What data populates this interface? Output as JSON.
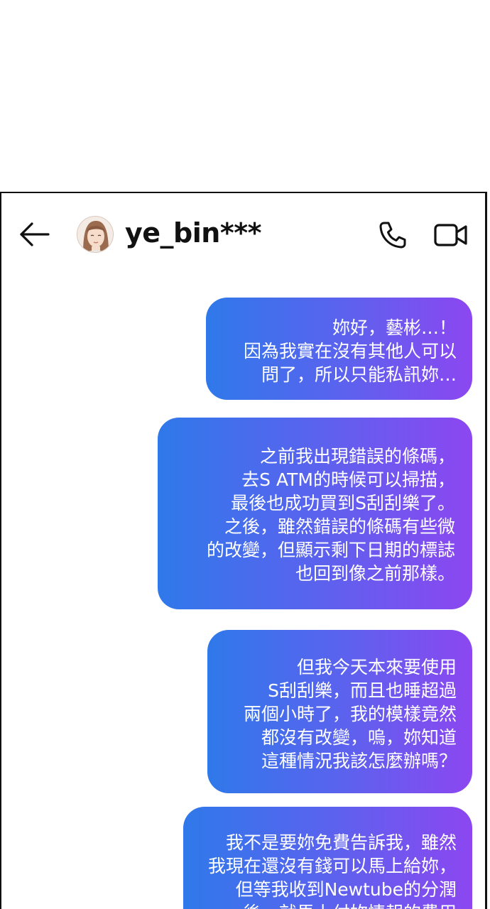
{
  "header": {
    "back_icon": "arrow-left-icon",
    "username": "ye_bin***",
    "call_icon": "phone-icon",
    "video_icon": "video-camera-icon"
  },
  "messages": [
    {
      "lines": [
        "妳好，藝彬…！",
        "因為我實在沒有其他人可以",
        "問了，所以只能私訊妳…"
      ]
    },
    {
      "lines": [
        "之前我出現錯誤的條碼，",
        "去S ATM的時候可以掃描，",
        "最後也成功買到S刮刮樂了。",
        "之後，雖然錯誤的條碼有些微",
        "的改變，但顯示剩下日期的標誌",
        "也回到像之前那樣。"
      ]
    },
    {
      "lines": [
        "但我今天本來要使用",
        "S刮刮樂，而且也睡超過",
        "兩個小時了，我的模樣竟然",
        "都沒有改變，嗚，妳知道",
        "這種情況我該怎麼辦嗎？"
      ]
    },
    {
      "lines": [
        "我不是要妳免費告訴我，雖然",
        "我現在還沒有錢可以馬上給妳，",
        "但等我收到Newtube的分潤",
        "後，就馬上付妳情報的費用"
      ]
    }
  ],
  "colors": {
    "bubble_gradient_start": "#2f79ea",
    "bubble_gradient_end": "#8c47f0",
    "text_on_bubble": "#ffffff",
    "frame_border": "#111111"
  }
}
